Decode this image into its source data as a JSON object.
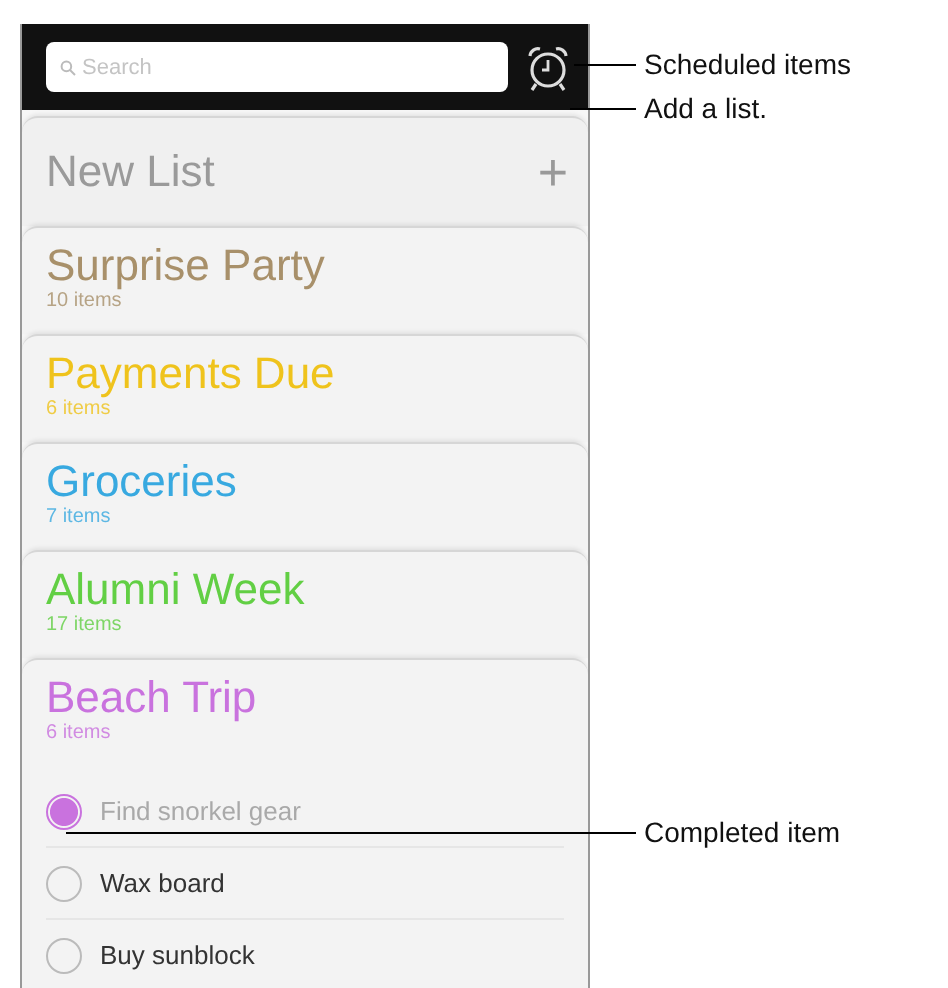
{
  "search": {
    "placeholder": "Search"
  },
  "new_list": {
    "label": "New List",
    "add": "+"
  },
  "lists": [
    {
      "name": "Surprise Party",
      "count": "10 items",
      "color": "#a8906a"
    },
    {
      "name": "Payments Due",
      "count": "6 items",
      "color": "#efc31c"
    },
    {
      "name": "Groceries",
      "count": "7 items",
      "color": "#38a9e0"
    },
    {
      "name": "Alumni Week",
      "count": "17 items",
      "color": "#62cf44"
    },
    {
      "name": "Beach Trip",
      "count": "6 items",
      "color": "#c972de"
    }
  ],
  "items": [
    {
      "text": "Find snorkel gear",
      "checked": true
    },
    {
      "text": "Wax board",
      "checked": false
    },
    {
      "text": "Buy sunblock",
      "checked": false
    }
  ],
  "callouts": [
    "Scheduled items",
    "Add a list.",
    "Completed item"
  ]
}
